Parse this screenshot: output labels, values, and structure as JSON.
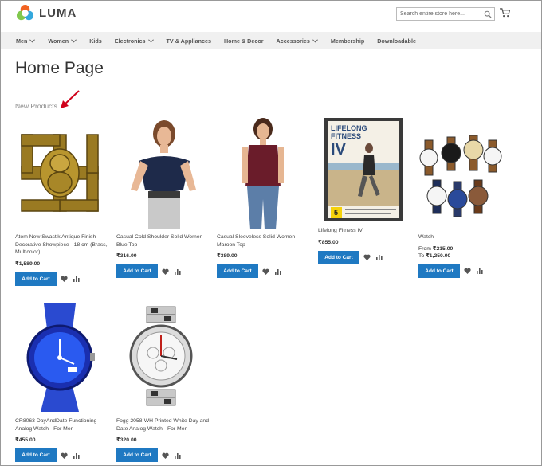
{
  "brand": {
    "name": "LUMA"
  },
  "search": {
    "placeholder": "Search entire store here..."
  },
  "nav": {
    "items": [
      {
        "label": "Men",
        "has_submenu": true
      },
      {
        "label": "Women",
        "has_submenu": true
      },
      {
        "label": "Kids",
        "has_submenu": false
      },
      {
        "label": "Electronics",
        "has_submenu": true
      },
      {
        "label": "TV & Appliances",
        "has_submenu": false
      },
      {
        "label": "Home & Decor",
        "has_submenu": false
      },
      {
        "label": "Accessories",
        "has_submenu": true
      },
      {
        "label": "Membership",
        "has_submenu": false
      },
      {
        "label": "Downloadable",
        "has_submenu": false
      }
    ]
  },
  "page": {
    "title": "Home Page",
    "section_label": "New Products"
  },
  "colors": {
    "accent": "#1f79c2",
    "annotation_arrow": "#d0021b",
    "nav_bg": "#f0f0f0"
  },
  "actions": {
    "add_to_cart": "Add to Cart"
  },
  "products": [
    {
      "name": "Atom New Swastik Antique Finish Decorative Showpiece - 18 cm (Brass, Multicolor)",
      "price": "₹1,589.00"
    },
    {
      "name": "Casual Cold Shoulder Solid Women Blue Top",
      "price": "₹316.00"
    },
    {
      "name": "Casual Sleeveless Solid Women Maroon Top",
      "price": "₹389.00"
    },
    {
      "name": "Lifelong Fitness IV",
      "price": "₹855.00"
    },
    {
      "name": "Watch",
      "price_from_label": "From",
      "price_from": "₹215.00",
      "price_to_label": "To",
      "price_to": "₹1,250.00"
    },
    {
      "name": "CR8063 DayAndDate Functioning Analog Watch - For Men",
      "price": "₹455.00"
    },
    {
      "name": "Fogg 2058-WH Printed White Day and Date Analog Watch - For Men",
      "price": "₹320.00"
    }
  ],
  "dvd_cover": {
    "title_line1": "LIFELONG",
    "title_line2": "FITNESS",
    "title_line3": "IV",
    "badge": "5"
  }
}
